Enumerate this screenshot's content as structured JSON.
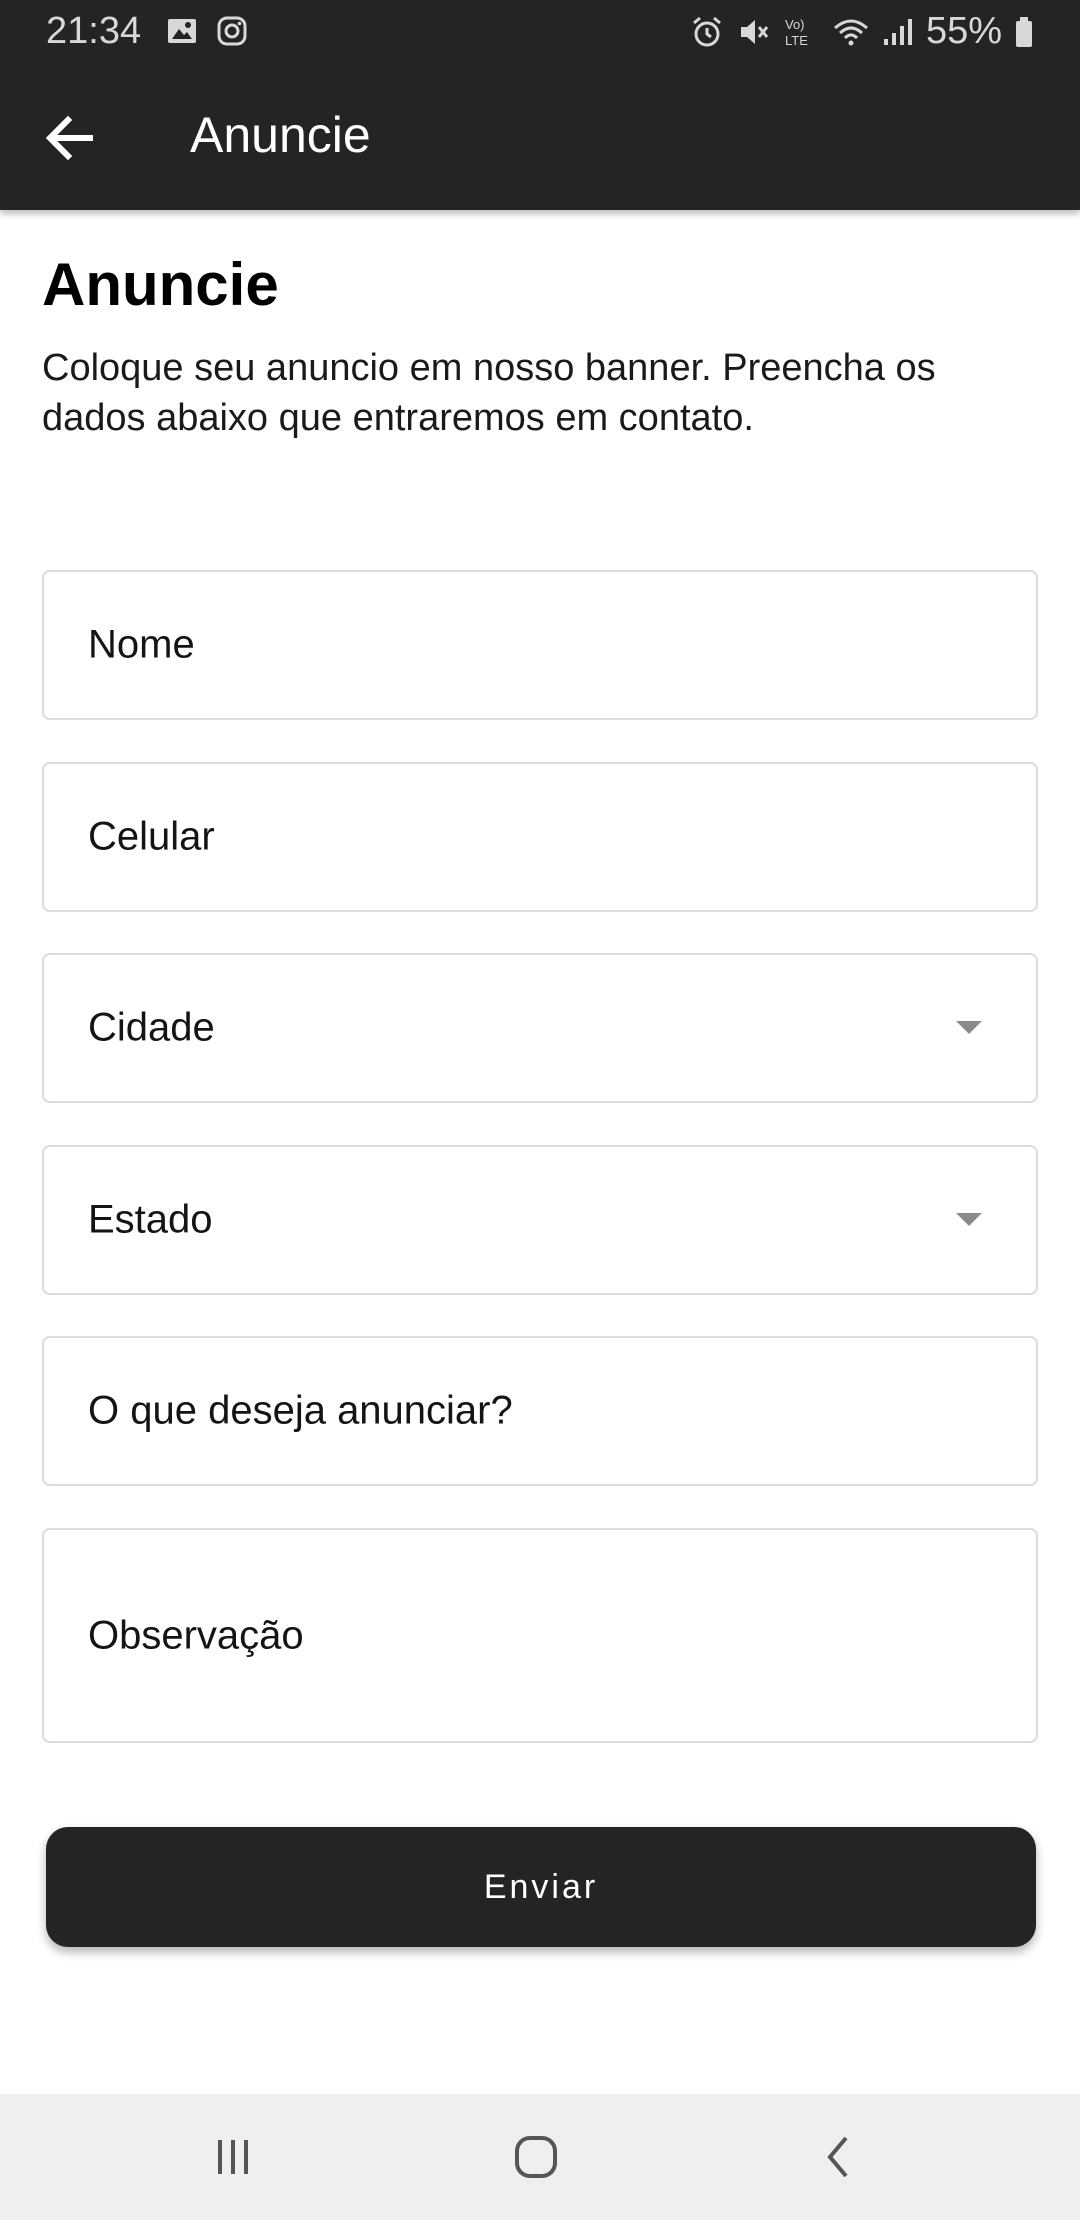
{
  "status_bar": {
    "time": "21:34",
    "battery": "55%",
    "icons": [
      "image-icon",
      "instagram-icon",
      "alarm-icon",
      "mute-icon",
      "volte-icon",
      "wifi-icon",
      "signal-icon",
      "battery-icon"
    ],
    "volte_label": "Vo)",
    "lte_label": "LTE"
  },
  "app_bar": {
    "title": "Anuncie",
    "back_icon": "arrow-back-icon"
  },
  "page": {
    "heading": "Anuncie",
    "description": "Coloque seu anuncio em nosso banner. Preencha os dados abaixo que entraremos em contato."
  },
  "form": {
    "name_placeholder": "Nome",
    "phone_placeholder": "Celular",
    "city_label": "Cidade",
    "state_label": "Estado",
    "ad_placeholder": "O que deseja anunciar?",
    "notes_placeholder": "Observação",
    "submit_label": "Enviar"
  },
  "nav_bar": {
    "icons": [
      "recent-apps-icon",
      "home-icon",
      "back-icon"
    ]
  },
  "colors": {
    "app_bar": "#242424",
    "button": "#242424",
    "field_border": "#dcdcdc",
    "nav_bar": "#efefef"
  }
}
